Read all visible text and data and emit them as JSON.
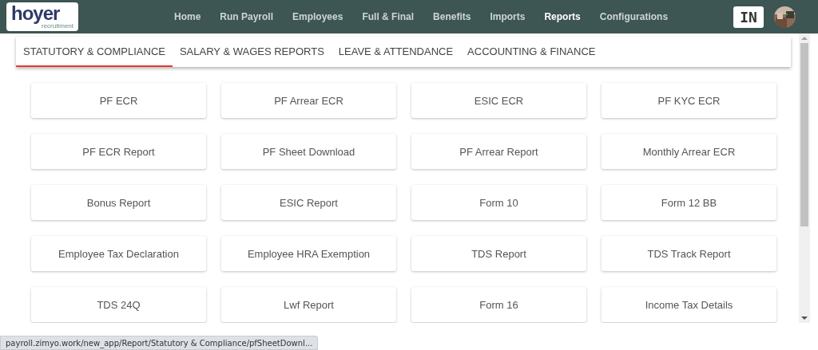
{
  "logo": {
    "name": "hoyer",
    "tagline": "recruitment"
  },
  "nav": [
    {
      "label": "Home",
      "selected": false
    },
    {
      "label": "Run Payroll",
      "selected": false
    },
    {
      "label": "Employees",
      "selected": false
    },
    {
      "label": "Full & Final",
      "selected": false
    },
    {
      "label": "Benefits",
      "selected": false
    },
    {
      "label": "Imports",
      "selected": false
    },
    {
      "label": "Reports",
      "selected": true
    },
    {
      "label": "Configurations",
      "selected": false
    }
  ],
  "language": "IN",
  "tabs": [
    {
      "label": "STATUTORY & COMPLIANCE",
      "selected": true
    },
    {
      "label": "SALARY & WAGES REPORTS",
      "selected": false
    },
    {
      "label": "LEAVE & ATTENDANCE",
      "selected": false
    },
    {
      "label": "ACCOUNTING & FINANCE",
      "selected": false
    }
  ],
  "reports": [
    "PF ECR",
    "PF Arrear ECR",
    "ESIC ECR",
    "PF KYC ECR",
    "PF ECR Report",
    "PF Sheet Download",
    "PF Arrear Report",
    "Monthly Arrear ECR",
    "Bonus Report",
    "ESIC Report",
    "Form 10",
    "Form 12 BB",
    "Employee Tax Declaration",
    "Employee HRA Exemption",
    "TDS Report",
    "TDS Track Report",
    "TDS 24Q",
    "Lwf Report",
    "Form 16",
    "Income Tax Details"
  ],
  "status_bar": "payroll.zimyo.work/new_app/Report/Statutory & Compliance/pfSheetDownl..."
}
